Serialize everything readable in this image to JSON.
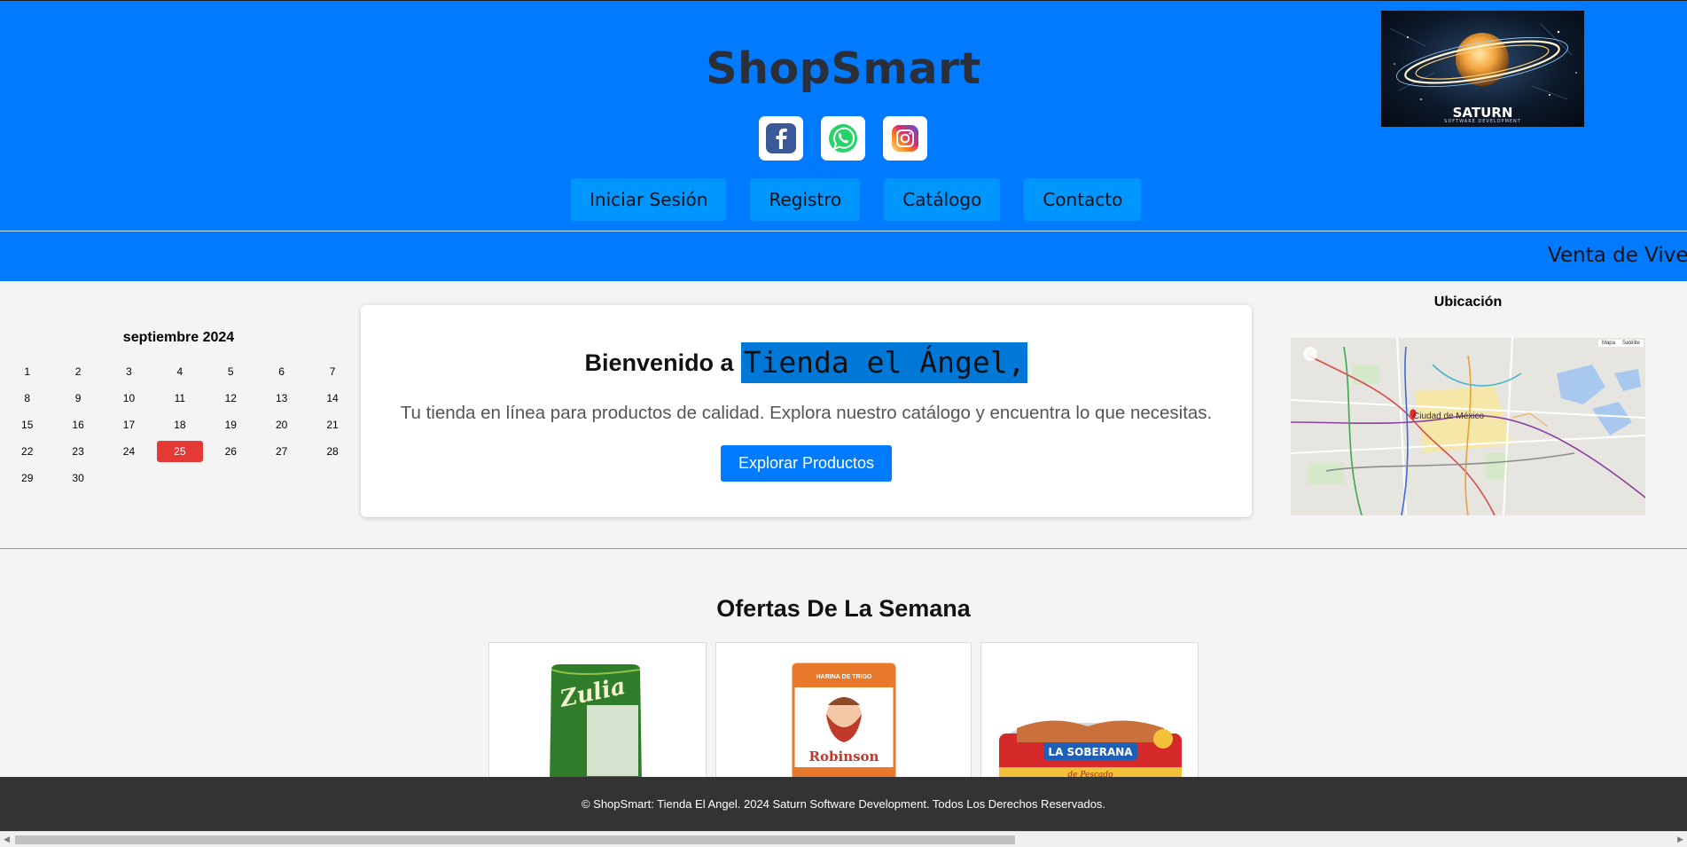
{
  "header": {
    "brand": "ShopSmart",
    "colors": {
      "header_bg": "#007bff",
      "nav_btn_bg": "#0096ff"
    },
    "social": [
      {
        "name": "facebook-icon"
      },
      {
        "name": "whatsapp-icon"
      },
      {
        "name": "instagram-icon"
      }
    ],
    "nav": [
      "Iniciar Sesión",
      "Registro",
      "Catálogo",
      "Contacto"
    ],
    "logo": {
      "text": "SATURN",
      "subtext": "SOFTWARE DEVELOPMENT"
    }
  },
  "ticker": {
    "text": "Venta de Viver"
  },
  "calendar": {
    "title": "septiembre 2024",
    "days": [
      "1",
      "2",
      "3",
      "4",
      "5",
      "6",
      "7",
      "8",
      "9",
      "10",
      "11",
      "12",
      "13",
      "14",
      "15",
      "16",
      "17",
      "18",
      "19",
      "20",
      "21",
      "22",
      "23",
      "24",
      "25",
      "26",
      "27",
      "28",
      "29",
      "30"
    ],
    "today": "25",
    "today_color": "#e53935"
  },
  "welcome": {
    "prefix": "Bienvenido a",
    "highlight": "Tienda el Ángel,",
    "description": "Tu tienda en línea para productos de calidad. Explora nuestro catálogo y encuentra lo que necesitas.",
    "button": "Explorar Productos"
  },
  "location": {
    "title": "Ubicación",
    "map_city": "Ciudad de México",
    "map_type": [
      "Mapa",
      "Satélite"
    ]
  },
  "offers": {
    "title": "Ofertas De La Semana",
    "products": [
      {
        "brand": "Zulia"
      },
      {
        "brand": "Robinson",
        "label": "HARINA DE TRIGO"
      },
      {
        "brand": "LA SOBERANA",
        "label": "de Pescado"
      }
    ]
  },
  "footer": {
    "text": "© ShopSmart: Tienda El Angel. 2024 Saturn Software Development. Todos Los Derechos Reservados."
  }
}
